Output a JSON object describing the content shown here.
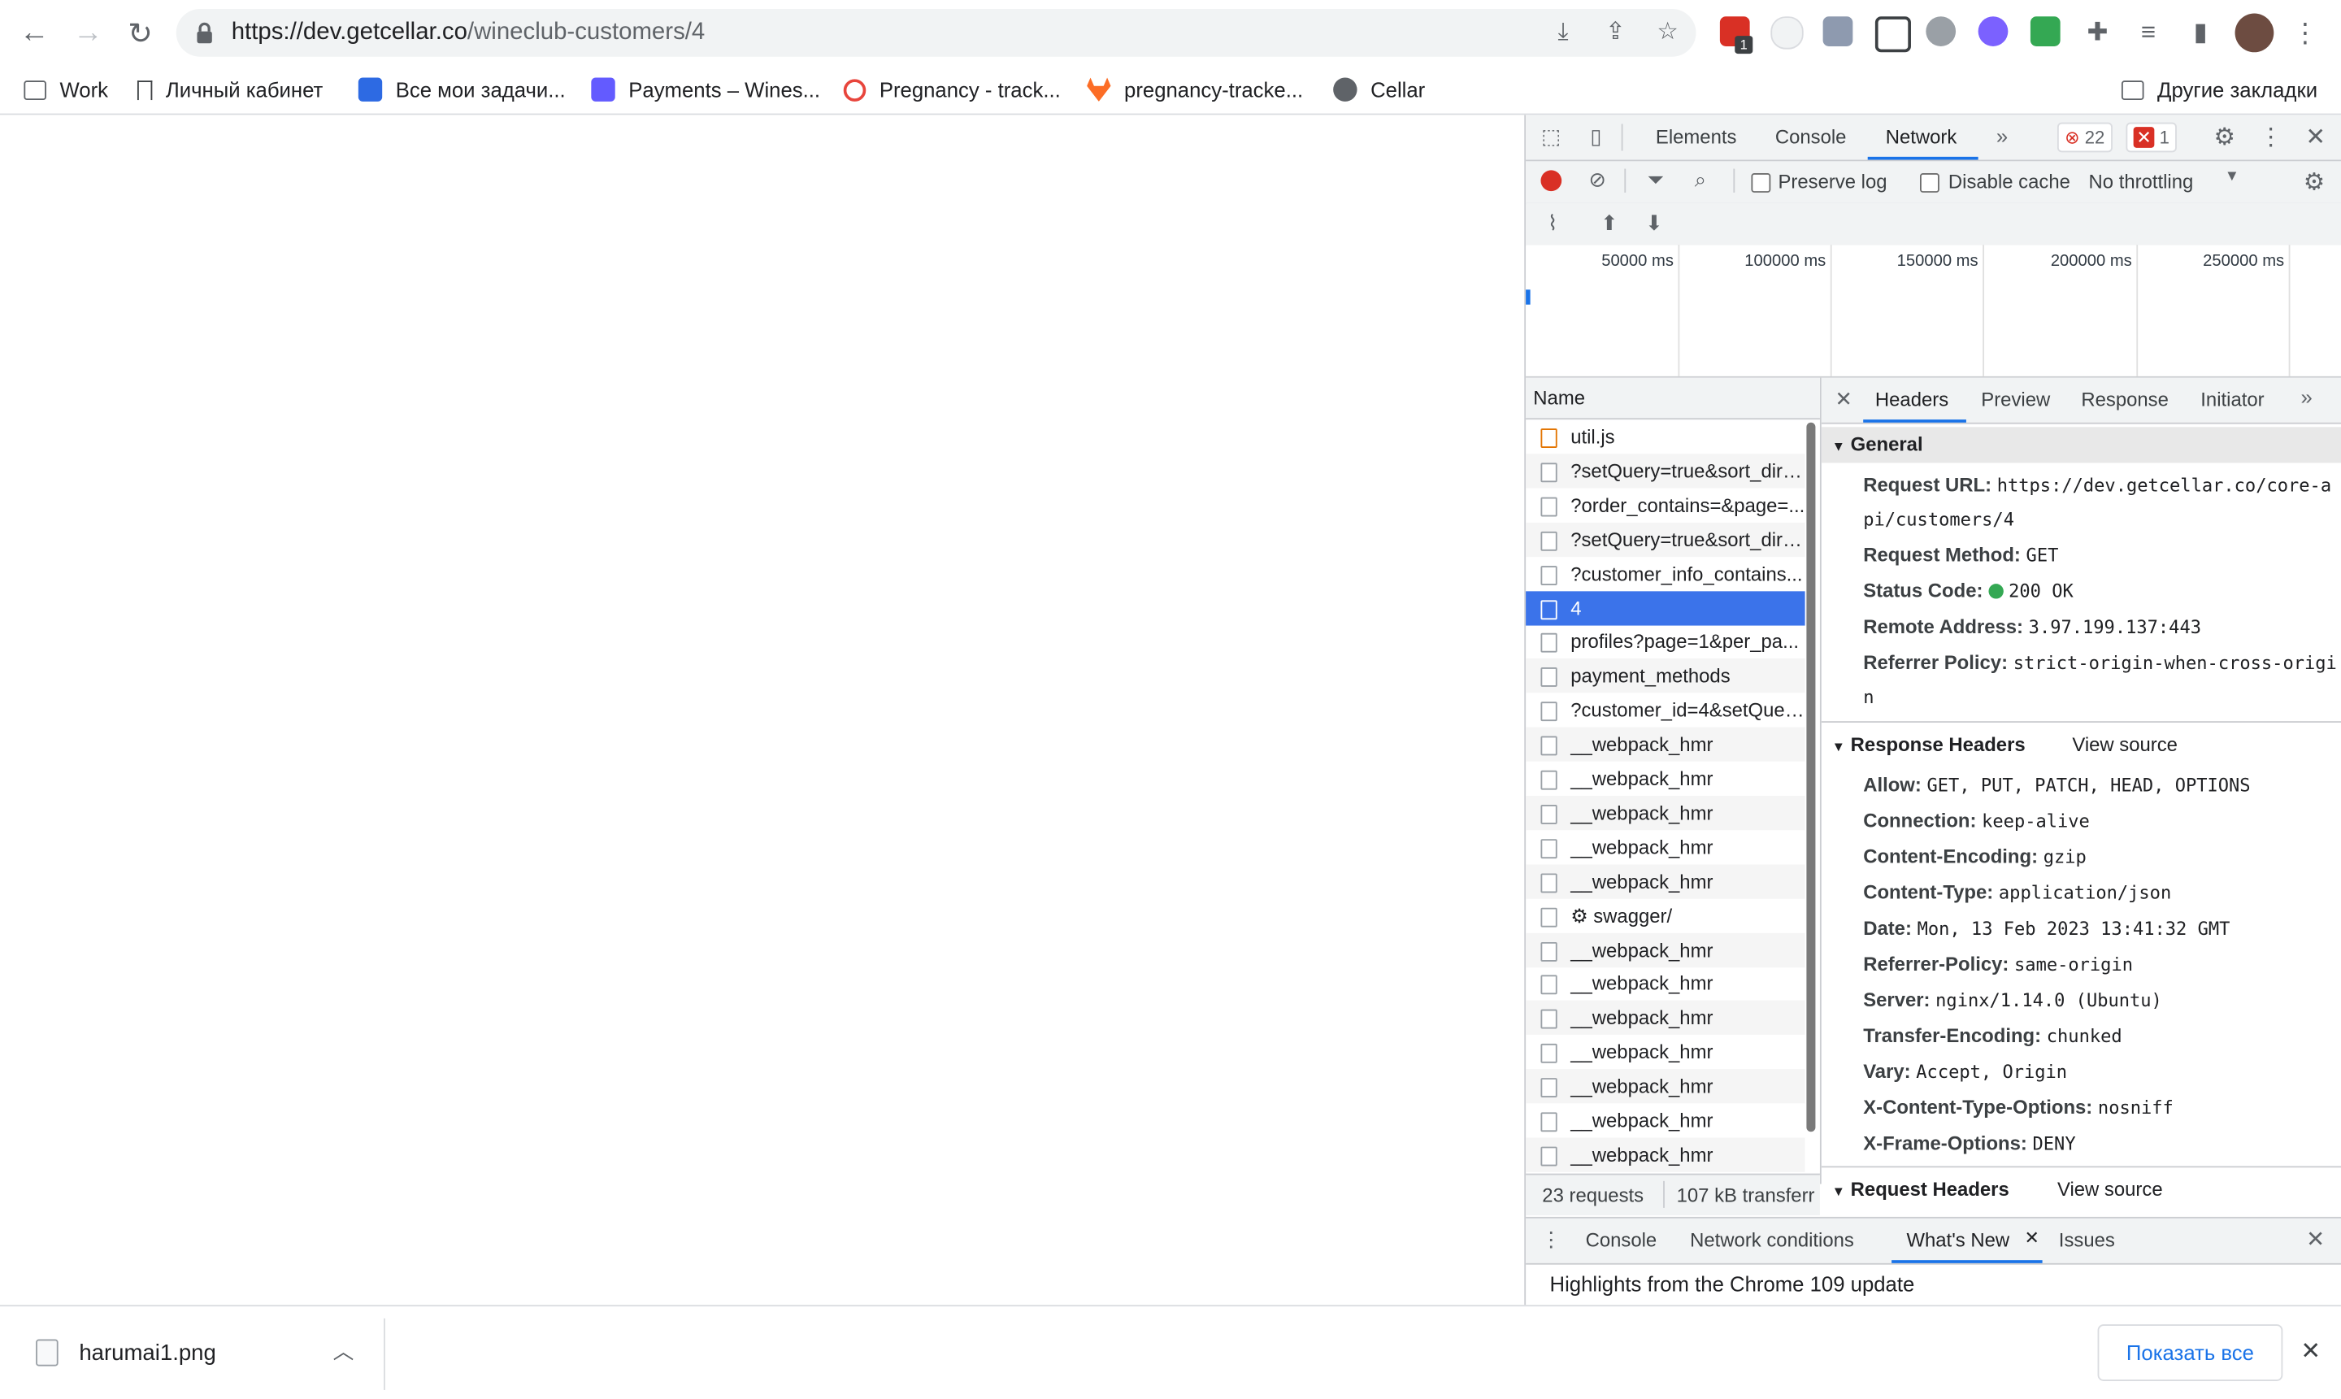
{
  "browser": {
    "url_host": "https://dev.getcellar.co",
    "url_path": "/wineclub-customers/4",
    "extension_badge": "1"
  },
  "bookmarks": [
    {
      "label": "Work",
      "icon": "folder-icon"
    },
    {
      "label": "Личный кабинет",
      "icon": "site-icon"
    },
    {
      "label": "Все мои задачи...",
      "icon": "tracker-icon"
    },
    {
      "label": "Payments – Wines...",
      "icon": "stripe-icon"
    },
    {
      "label": "Pregnancy - track...",
      "icon": "spinner-icon"
    },
    {
      "label": "pregnancy-tracke...",
      "icon": "gitlab-icon"
    },
    {
      "label": "Cellar",
      "icon": "globe-icon"
    }
  ],
  "bookmarks_other": "Другие закладки",
  "devtools": {
    "tabs": [
      "Elements",
      "Console",
      "Network"
    ],
    "active_tab": "Network",
    "error_count": "22",
    "issue_count": "1",
    "preserve_log": "Preserve log",
    "disable_cache": "Disable cache",
    "throttling": "No throttling",
    "overview_ticks": [
      "50000 ms",
      "100000 ms",
      "150000 ms",
      "200000 ms",
      "250000 ms"
    ],
    "list_header": "Name",
    "requests": [
      "util.js",
      "?setQuery=true&sort_dire...",
      "?order_contains=&page=...",
      "?setQuery=true&sort_dire...",
      "?customer_info_contains...",
      "4",
      "profiles?page=1&per_pa...",
      "payment_methods",
      "?customer_id=4&setQuer...",
      "__webpack_hmr",
      "__webpack_hmr",
      "__webpack_hmr",
      "__webpack_hmr",
      "__webpack_hmr",
      "⚙ swagger/",
      "__webpack_hmr",
      "__webpack_hmr",
      "__webpack_hmr",
      "__webpack_hmr",
      "__webpack_hmr",
      "__webpack_hmr",
      "__webpack_hmr"
    ],
    "requests_count": "23 requests",
    "transferred": "107 kB transferr",
    "detail_tabs": [
      "Headers",
      "Preview",
      "Response",
      "Initiator"
    ],
    "general": {
      "title": "General",
      "request_url_label": "Request URL:",
      "request_url_line1": "https://dev.getcellar.co/core-a",
      "request_url_line2": "pi/customers/4",
      "method_label": "Request Method:",
      "method": "GET",
      "status_label": "Status Code:",
      "status": "200 OK",
      "remote_label": "Remote Address:",
      "remote": "3.97.199.137:443",
      "referrer_label": "Referrer Policy:",
      "referrer_line1": "strict-origin-when-cross-origi",
      "referrer_line2": "n"
    },
    "response_headers": {
      "title": "Response Headers",
      "view_source": "View source",
      "items": [
        {
          "k": "Allow:",
          "v": "GET, PUT, PATCH, HEAD, OPTIONS"
        },
        {
          "k": "Connection:",
          "v": "keep-alive"
        },
        {
          "k": "Content-Encoding:",
          "v": "gzip"
        },
        {
          "k": "Content-Type:",
          "v": "application/json"
        },
        {
          "k": "Date:",
          "v": "Mon, 13 Feb 2023 13:41:32 GMT"
        },
        {
          "k": "Referrer-Policy:",
          "v": "same-origin"
        },
        {
          "k": "Server:",
          "v": "nginx/1.14.0 (Ubuntu)"
        },
        {
          "k": "Transfer-Encoding:",
          "v": "chunked"
        },
        {
          "k": "Vary:",
          "v": "Accept, Origin"
        },
        {
          "k": "X-Content-Type-Options:",
          "v": "nosniff"
        },
        {
          "k": "X-Frame-Options:",
          "v": "DENY"
        }
      ]
    },
    "request_headers": {
      "title": "Request Headers",
      "view_source": "View source"
    },
    "drawer_tabs": [
      "Console",
      "Network conditions",
      "What's New",
      "Issues"
    ],
    "drawer_active": "What's New",
    "drawer_text": "Highlights from the Chrome 109 update"
  },
  "downloads": {
    "file": "harumai1.png",
    "show_all": "Показать все"
  },
  "colors": {
    "accent": "#1a73e8",
    "selected_row": "#3b73ea",
    "record": "#d93025",
    "status_ok": "#34a853"
  }
}
